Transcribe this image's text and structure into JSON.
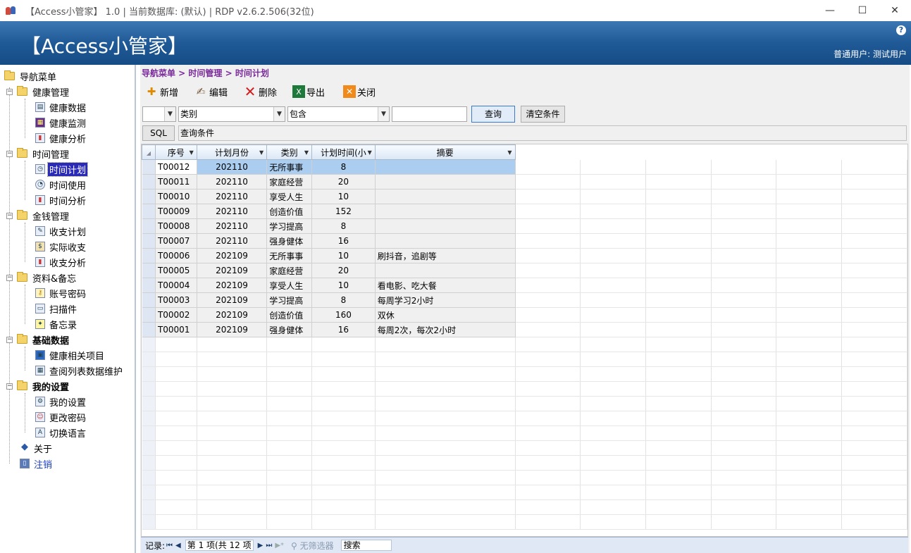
{
  "window": {
    "title": "【Access小管家】 1.0 | 当前数据库: (默认) | RDP v2.6.2.506(32位)",
    "minimize": "—",
    "maximize": "☐",
    "close": "✕"
  },
  "banner": {
    "app_title": "【Access小管家】",
    "help": "?",
    "user": "普通用户: 测试用户"
  },
  "sidebar": {
    "root": "导航菜单",
    "groups": [
      {
        "label": "健康管理",
        "items": [
          "健康数据",
          "健康监测",
          "健康分析"
        ]
      },
      {
        "label": "时间管理",
        "items": [
          "时间计划",
          "时间使用",
          "时间分析"
        ]
      },
      {
        "label": "金钱管理",
        "items": [
          "收支计划",
          "实际收支",
          "收支分析"
        ]
      },
      {
        "label": "资料&备忘",
        "items": [
          "账号密码",
          "扫描件",
          "备忘录"
        ]
      },
      {
        "label": "基础数据",
        "items": [
          "健康相关项目",
          "查阅列表数据维护"
        ]
      },
      {
        "label": "我的设置",
        "items": [
          "我的设置",
          "更改密码",
          "切换语言"
        ]
      }
    ],
    "about": "关于",
    "logout": "注销"
  },
  "breadcrumb": "导航菜单 > 时间管理 > 时间计划",
  "toolbar": {
    "add": "新增",
    "edit": "编辑",
    "delete": "删除",
    "export": "导出",
    "close": "关闭"
  },
  "filter": {
    "logic_value": "",
    "field_value": "类别",
    "operator_value": "包含",
    "text_value": "",
    "query_label": "查询",
    "clear_label": "清空条件",
    "sql_label": "SQL",
    "sql_text": "查询条件"
  },
  "grid": {
    "columns": [
      "序号",
      "计划月份",
      "类别",
      "计划时间(小",
      "摘要"
    ],
    "rows": [
      [
        "T00012",
        "202110",
        "无所事事",
        "8",
        ""
      ],
      [
        "T00011",
        "202110",
        "家庭经营",
        "20",
        ""
      ],
      [
        "T00010",
        "202110",
        "享受人生",
        "10",
        ""
      ],
      [
        "T00009",
        "202110",
        "创造价值",
        "152",
        ""
      ],
      [
        "T00008",
        "202110",
        "学习提高",
        "8",
        ""
      ],
      [
        "T00007",
        "202110",
        "强身健体",
        "16",
        ""
      ],
      [
        "T00006",
        "202109",
        "无所事事",
        "10",
        "刷抖音，追剧等"
      ],
      [
        "T00005",
        "202109",
        "家庭经营",
        "20",
        ""
      ],
      [
        "T00004",
        "202109",
        "享受人生",
        "10",
        "看电影、吃大餐"
      ],
      [
        "T00003",
        "202109",
        "学习提高",
        "8",
        "每周学习2小时"
      ],
      [
        "T00002",
        "202109",
        "创造价值",
        "160",
        "双休"
      ],
      [
        "T00001",
        "202109",
        "强身健体",
        "16",
        "每周2次，每次2小时"
      ]
    ]
  },
  "statusbar": {
    "record_label": "记录:",
    "position": "第 1 项(共 12 项",
    "filter": "无筛选器",
    "search": "搜索"
  },
  "colors": {
    "banner_top": "#3d77b3",
    "banner_bottom": "#164c85",
    "breadcrumb": "#7a2a9a",
    "selection": "#aacdf0",
    "tree_selected": "#2a2ab8"
  }
}
